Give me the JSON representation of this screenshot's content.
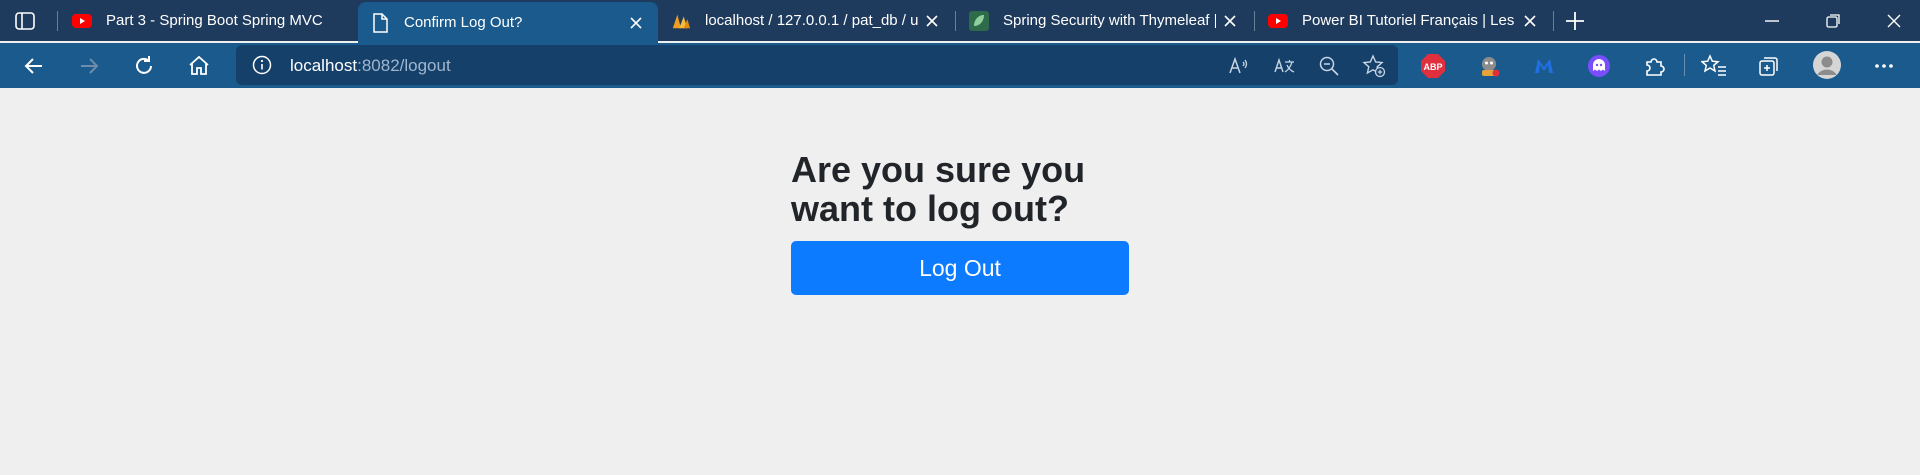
{
  "browser": {
    "tabs": [
      {
        "title": "Part 3 - Spring Boot Spring MVC",
        "favicon": "youtube-icon",
        "active": false
      },
      {
        "title": "Confirm Log Out?",
        "favicon": "page-icon",
        "active": true
      },
      {
        "title": "localhost / 127.0.0.1 / pat_db / u",
        "favicon": "phpmyadmin-icon",
        "active": false
      },
      {
        "title": "Spring Security with Thymeleaf |",
        "favicon": "leaf-icon",
        "active": false
      },
      {
        "title": "Power BI Tutoriel Français | Les b",
        "favicon": "youtube-icon",
        "active": false
      }
    ],
    "address_bar": {
      "host": "localhost",
      "path": ":8082/logout"
    },
    "extensions": [
      {
        "name": "adblock-plus-icon",
        "label": "ABP"
      },
      {
        "name": "extension-helper-icon"
      },
      {
        "name": "malwarebytes-icon"
      },
      {
        "name": "ghost-extension-icon"
      },
      {
        "name": "extensions-puzzle-icon"
      },
      {
        "name": "favorites-icon"
      },
      {
        "name": "collections-icon"
      },
      {
        "name": "profile-avatar"
      },
      {
        "name": "more-menu-icon"
      }
    ]
  },
  "page": {
    "question": "Are you sure you want to log out?",
    "logout_button": "Log Out"
  },
  "colors": {
    "tabstrip": "#1e3a5c",
    "toolbar": "#1b5a8c",
    "page_background": "#efefef",
    "primary_button": "#0d7bff"
  }
}
